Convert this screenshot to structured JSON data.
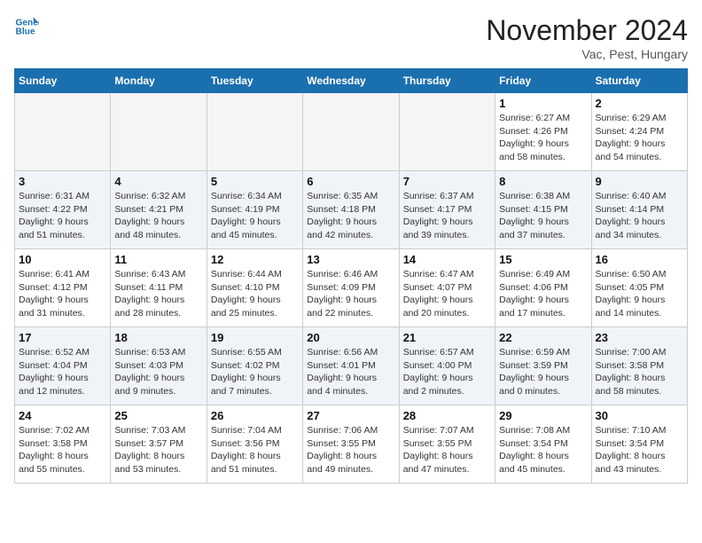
{
  "header": {
    "logo_line1": "General",
    "logo_line2": "Blue",
    "month_title": "November 2024",
    "location": "Vac, Pest, Hungary"
  },
  "weekdays": [
    "Sunday",
    "Monday",
    "Tuesday",
    "Wednesday",
    "Thursday",
    "Friday",
    "Saturday"
  ],
  "weeks": [
    [
      {
        "day": "",
        "info": ""
      },
      {
        "day": "",
        "info": ""
      },
      {
        "day": "",
        "info": ""
      },
      {
        "day": "",
        "info": ""
      },
      {
        "day": "",
        "info": ""
      },
      {
        "day": "1",
        "info": "Sunrise: 6:27 AM\nSunset: 4:26 PM\nDaylight: 9 hours\nand 58 minutes."
      },
      {
        "day": "2",
        "info": "Sunrise: 6:29 AM\nSunset: 4:24 PM\nDaylight: 9 hours\nand 54 minutes."
      }
    ],
    [
      {
        "day": "3",
        "info": "Sunrise: 6:31 AM\nSunset: 4:22 PM\nDaylight: 9 hours\nand 51 minutes."
      },
      {
        "day": "4",
        "info": "Sunrise: 6:32 AM\nSunset: 4:21 PM\nDaylight: 9 hours\nand 48 minutes."
      },
      {
        "day": "5",
        "info": "Sunrise: 6:34 AM\nSunset: 4:19 PM\nDaylight: 9 hours\nand 45 minutes."
      },
      {
        "day": "6",
        "info": "Sunrise: 6:35 AM\nSunset: 4:18 PM\nDaylight: 9 hours\nand 42 minutes."
      },
      {
        "day": "7",
        "info": "Sunrise: 6:37 AM\nSunset: 4:17 PM\nDaylight: 9 hours\nand 39 minutes."
      },
      {
        "day": "8",
        "info": "Sunrise: 6:38 AM\nSunset: 4:15 PM\nDaylight: 9 hours\nand 37 minutes."
      },
      {
        "day": "9",
        "info": "Sunrise: 6:40 AM\nSunset: 4:14 PM\nDaylight: 9 hours\nand 34 minutes."
      }
    ],
    [
      {
        "day": "10",
        "info": "Sunrise: 6:41 AM\nSunset: 4:12 PM\nDaylight: 9 hours\nand 31 minutes."
      },
      {
        "day": "11",
        "info": "Sunrise: 6:43 AM\nSunset: 4:11 PM\nDaylight: 9 hours\nand 28 minutes."
      },
      {
        "day": "12",
        "info": "Sunrise: 6:44 AM\nSunset: 4:10 PM\nDaylight: 9 hours\nand 25 minutes."
      },
      {
        "day": "13",
        "info": "Sunrise: 6:46 AM\nSunset: 4:09 PM\nDaylight: 9 hours\nand 22 minutes."
      },
      {
        "day": "14",
        "info": "Sunrise: 6:47 AM\nSunset: 4:07 PM\nDaylight: 9 hours\nand 20 minutes."
      },
      {
        "day": "15",
        "info": "Sunrise: 6:49 AM\nSunset: 4:06 PM\nDaylight: 9 hours\nand 17 minutes."
      },
      {
        "day": "16",
        "info": "Sunrise: 6:50 AM\nSunset: 4:05 PM\nDaylight: 9 hours\nand 14 minutes."
      }
    ],
    [
      {
        "day": "17",
        "info": "Sunrise: 6:52 AM\nSunset: 4:04 PM\nDaylight: 9 hours\nand 12 minutes."
      },
      {
        "day": "18",
        "info": "Sunrise: 6:53 AM\nSunset: 4:03 PM\nDaylight: 9 hours\nand 9 minutes."
      },
      {
        "day": "19",
        "info": "Sunrise: 6:55 AM\nSunset: 4:02 PM\nDaylight: 9 hours\nand 7 minutes."
      },
      {
        "day": "20",
        "info": "Sunrise: 6:56 AM\nSunset: 4:01 PM\nDaylight: 9 hours\nand 4 minutes."
      },
      {
        "day": "21",
        "info": "Sunrise: 6:57 AM\nSunset: 4:00 PM\nDaylight: 9 hours\nand 2 minutes."
      },
      {
        "day": "22",
        "info": "Sunrise: 6:59 AM\nSunset: 3:59 PM\nDaylight: 9 hours\nand 0 minutes."
      },
      {
        "day": "23",
        "info": "Sunrise: 7:00 AM\nSunset: 3:58 PM\nDaylight: 8 hours\nand 58 minutes."
      }
    ],
    [
      {
        "day": "24",
        "info": "Sunrise: 7:02 AM\nSunset: 3:58 PM\nDaylight: 8 hours\nand 55 minutes."
      },
      {
        "day": "25",
        "info": "Sunrise: 7:03 AM\nSunset: 3:57 PM\nDaylight: 8 hours\nand 53 minutes."
      },
      {
        "day": "26",
        "info": "Sunrise: 7:04 AM\nSunset: 3:56 PM\nDaylight: 8 hours\nand 51 minutes."
      },
      {
        "day": "27",
        "info": "Sunrise: 7:06 AM\nSunset: 3:55 PM\nDaylight: 8 hours\nand 49 minutes."
      },
      {
        "day": "28",
        "info": "Sunrise: 7:07 AM\nSunset: 3:55 PM\nDaylight: 8 hours\nand 47 minutes."
      },
      {
        "day": "29",
        "info": "Sunrise: 7:08 AM\nSunset: 3:54 PM\nDaylight: 8 hours\nand 45 minutes."
      },
      {
        "day": "30",
        "info": "Sunrise: 7:10 AM\nSunset: 3:54 PM\nDaylight: 8 hours\nand 43 minutes."
      }
    ]
  ]
}
